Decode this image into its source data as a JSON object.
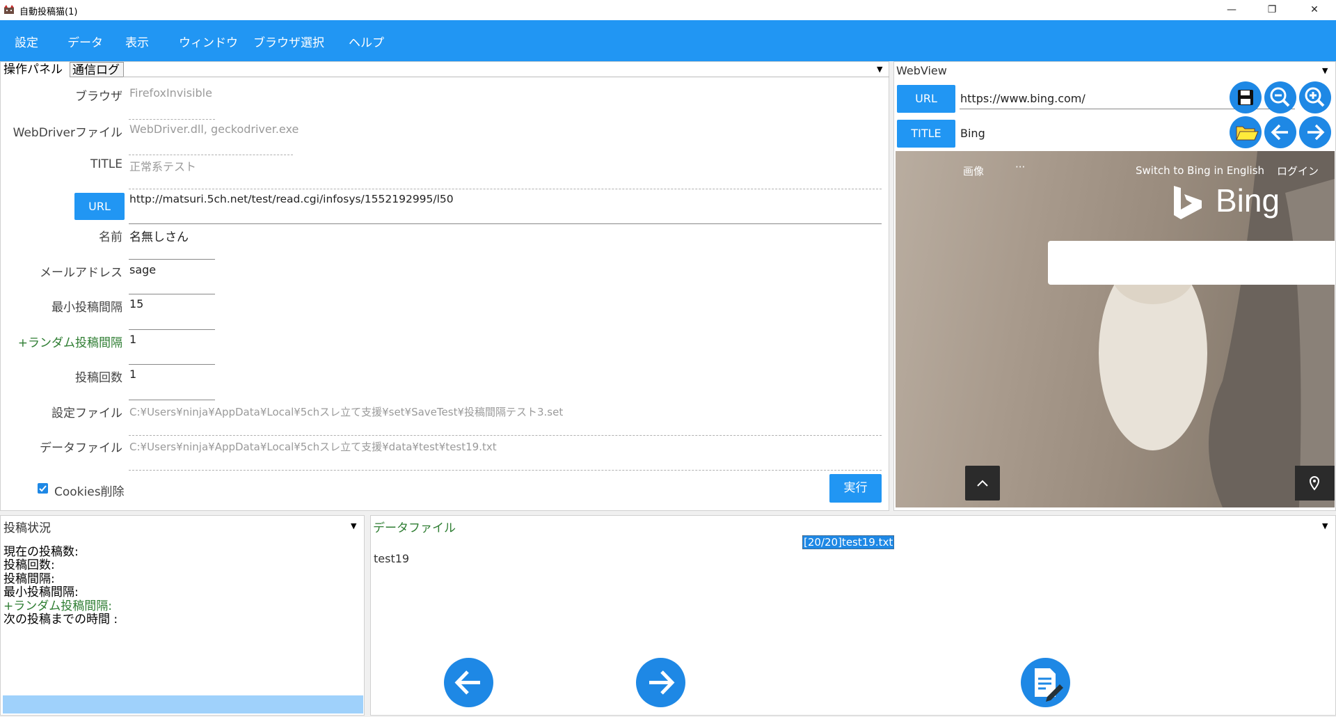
{
  "window": {
    "title": "自動投稿猫(1)",
    "controls": {
      "minimize": "—",
      "restore": "❐",
      "close": "✕"
    }
  },
  "menu": {
    "items": [
      "設定",
      "データ",
      "表示",
      "ウィンドウ",
      "ブラウザ選択",
      "ヘルプ"
    ]
  },
  "control_panel": {
    "tabs": [
      "操作パネル",
      "通信ログ"
    ],
    "fields": {
      "browser": {
        "label": "ブラウザ",
        "value": "FirefoxInvisible"
      },
      "webdriver": {
        "label": "WebDriverファイル",
        "value": "WebDriver.dll, geckodriver.exe"
      },
      "title": {
        "label": "TITLE",
        "value": "正常系テスト"
      },
      "url": {
        "button": "URL",
        "value": "http://matsuri.5ch.net/test/read.cgi/infosys/1552192995/l50"
      },
      "name": {
        "label": "名前",
        "value": "名無しさん"
      },
      "email": {
        "label": "メールアドレス",
        "value": "sage"
      },
      "min_interval": {
        "label": "最小投稿間隔",
        "value": "15"
      },
      "random_interval": {
        "label": "+ランダム投稿間隔",
        "value": "1"
      },
      "post_count": {
        "label": "投稿回数",
        "value": "1"
      },
      "settings_file": {
        "label": "設定ファイル",
        "value": "C:¥Users¥ninja¥AppData¥Local¥5chスレ立て支援¥set¥SaveTest¥投稿間隔テスト3.set"
      },
      "data_file": {
        "label": "データファイル",
        "value": "C:¥Users¥ninja¥AppData¥Local¥5chスレ立て支援¥data¥test¥test19.txt"
      }
    },
    "cookies_checkbox": {
      "label": "Cookies削除",
      "checked": true
    },
    "run_button": "実行"
  },
  "webview": {
    "header": "WebView",
    "url_button": "URL",
    "url_value": "https://www.bing.com/",
    "title_button": "TITLE",
    "title_value": "Bing",
    "page": {
      "nav_images": "画像",
      "nav_more": "···",
      "switch_english": "Switch to Bing in English",
      "login": "ログイン",
      "logo": "Bing"
    }
  },
  "post_status": {
    "header": "投稿状況",
    "lines": [
      "現在の投稿数:",
      "投稿回数:",
      "投稿間隔:",
      "最小投稿間隔:",
      "+ランダム投稿間隔:",
      "次の投稿までの時間 :"
    ]
  },
  "data_file_panel": {
    "header": "データファイル",
    "file_indicator": "[20/20]test19.txt",
    "content": "test19"
  },
  "colors": {
    "accent": "#2196f3",
    "progress": "#9fd1fb"
  }
}
